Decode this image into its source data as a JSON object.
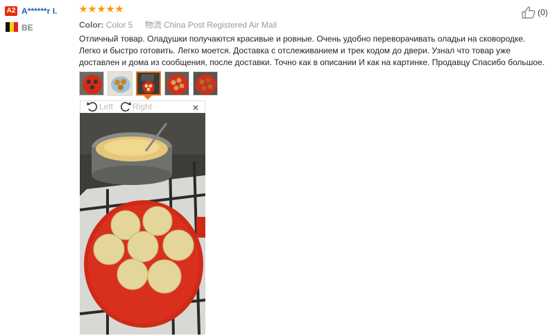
{
  "reviewer": {
    "badge": "A2",
    "name": "A******r I.",
    "country": "BE",
    "flag_colors": [
      "#111111",
      "#f5d10c",
      "#e0202c"
    ]
  },
  "rating": {
    "stars": 5,
    "color": "#ff9a00"
  },
  "order": {
    "color_label": "Color:",
    "color_value": "Color 5",
    "shipping": "物流 China Post Registered Air Mail"
  },
  "helpful": {
    "icon": "thumbs-up-icon",
    "count": "(0)"
  },
  "review": {
    "text": "Отличный товар. Оладушки получаются красивые и ровные. Очень удобно переворачивать оладьи на сковородке. Легко и быстро готовить. Легко моется. Доставка с отслеживанием и трек кодом до двери. Узнал что товар уже доставлен и дома из сообщения, после доставки. Точно как в описании И как на картинке. Продавцу Спасибо большое."
  },
  "viewer": {
    "rotate_left": "Left",
    "rotate_right": "Right",
    "close": "×",
    "selected_thumb_index": 2,
    "accent": "#f0751f"
  }
}
